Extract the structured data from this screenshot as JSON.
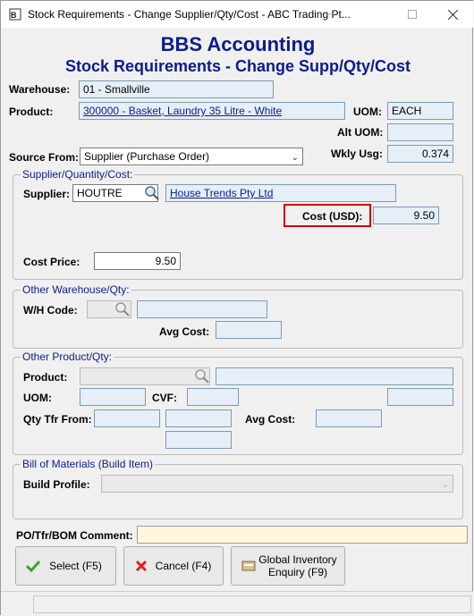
{
  "window": {
    "title": "Stock Requirements - Change Supplier/Qty/Cost - ABC Trading Pt..."
  },
  "header": {
    "app_name": "BBS Accounting",
    "subtitle": "Stock Requirements - Change Supp/Qty/Cost"
  },
  "warehouse": {
    "label": "Warehouse:",
    "value": "01 - Smallville"
  },
  "product": {
    "label": "Product:",
    "value": "300000 - Basket, Laundry 35 Litre - White"
  },
  "uom": {
    "label": "UOM:",
    "value": "EACH"
  },
  "alt_uom": {
    "label": "Alt UOM:",
    "value": ""
  },
  "source_from": {
    "label": "Source From:",
    "value": "Supplier (Purchase Order)"
  },
  "wkly_usg": {
    "label": "Wkly Usg:",
    "value": "0.374"
  },
  "supplier_group": {
    "caption": "Supplier/Quantity/Cost:",
    "supplier_label": "Supplier:",
    "supplier_code": "HOUTRE",
    "supplier_name": "House Trends Pty Ltd",
    "cost_label": "Cost (USD):",
    "cost_value": "9.50",
    "cost_price_label": "Cost Price:",
    "cost_price_value": "9.50"
  },
  "other_warehouse": {
    "caption": "Other Warehouse/Qty:",
    "wh_code_label": "W/H Code:",
    "avg_cost_label": "Avg Cost:"
  },
  "other_product": {
    "caption": "Other Product/Qty:",
    "product_label": "Product:",
    "uom_label": "UOM:",
    "cvf_label": "CVF:",
    "qty_tfr_label": "Qty Tfr From:",
    "avg_cost_label": "Avg Cost:"
  },
  "bom": {
    "caption": "Bill of Materials (Build Item)",
    "build_profile_label": "Build Profile:"
  },
  "comment": {
    "label": "PO/Tfr/BOM Comment:",
    "value": ""
  },
  "buttons": {
    "select": "Select (F5)",
    "cancel": "Cancel (F4)",
    "global_line1": "Global Inventory",
    "global_line2": "Enquiry (F9)"
  },
  "colors": {
    "heading": "#0c1c8c",
    "highlight": "#d00000",
    "field_bg": "#e6eef7"
  },
  "icons": [
    "app-icon",
    "minimize-icon",
    "maximize-icon",
    "close-icon",
    "search-icon",
    "chevron-down-icon",
    "check-icon",
    "cross-icon",
    "inventory-icon"
  ]
}
